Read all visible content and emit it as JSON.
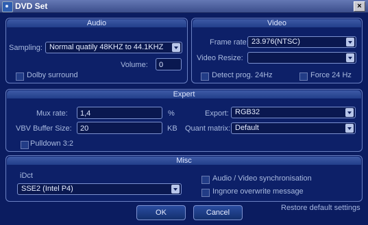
{
  "window": {
    "title": "DVD Set",
    "close_glyph": "×"
  },
  "audio": {
    "header": "Audio",
    "sampling_label": "Sampling:",
    "sampling_value": "Normal quatily 48KHZ to 44.1KHZ",
    "volume_label": "Volume:",
    "volume_value": "0",
    "dolby_label": "Dolby surround"
  },
  "video": {
    "header": "Video",
    "frame_rate_label": "Frame rate:",
    "frame_rate_value": "23.976(NTSC)",
    "resize_label": "Video Resize:",
    "resize_value": "",
    "detect_label": "Detect prog. 24Hz",
    "force_label": "Force 24 Hz"
  },
  "expert": {
    "header": "Expert",
    "mux_label": "Mux  rate:",
    "mux_value": "1,4",
    "mux_unit": "%",
    "vbv_label": "VBV Buffer Size:",
    "vbv_value": "20",
    "vbv_unit": "KB",
    "export_label": "Export:",
    "export_value": "RGB32",
    "quant_label": "Quant matrix:",
    "quant_value": "Default",
    "pulldown_label": "Pulldown 3:2"
  },
  "misc": {
    "header": "Misc",
    "idct_label": "iDct",
    "idct_value": "SSE2 (Intel P4)",
    "av_sync_label": "Audio / Video synchronisation",
    "ignore_label": "Ingnore  overwrite message"
  },
  "buttons": {
    "ok": "OK",
    "cancel": "Cancel",
    "restore": "Restore default settings"
  }
}
